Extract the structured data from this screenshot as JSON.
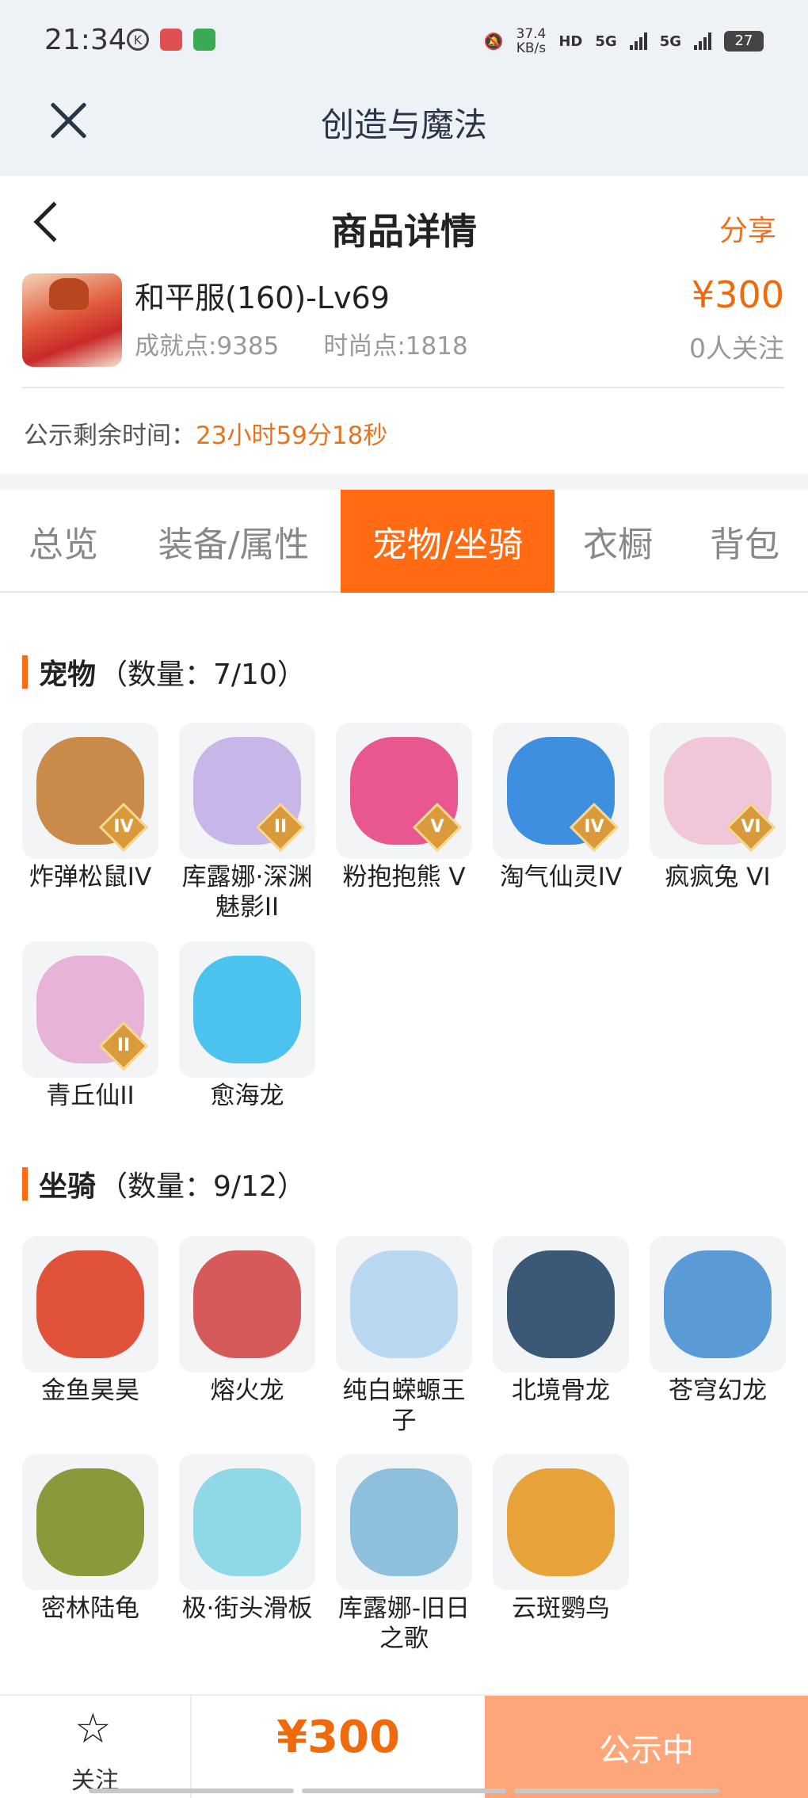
{
  "status_bar": {
    "time": "21:34",
    "speed_value": "37.4",
    "speed_unit": "KB/s",
    "hd_label": "HD",
    "sig1": "5G",
    "sig2": "5G",
    "battery": "27"
  },
  "app_bar": {
    "title": "创造与魔法",
    "close_icon": "close-icon"
  },
  "header": {
    "title": "商品详情",
    "share_label": "分享",
    "back_icon": "back-icon"
  },
  "product": {
    "name": "和平服(160)-Lv69",
    "achievement": "成就点:9385",
    "fashion": "时尚点:1818",
    "price": "¥300",
    "follows": "0人关注",
    "notice_label": "公示剩余时间：",
    "notice_time": "23小时59分18秒"
  },
  "tabs": [
    "总览",
    "装备/属性",
    "宠物/坐骑",
    "衣橱",
    "背包"
  ],
  "active_tab": 2,
  "pets": {
    "title": "宠物",
    "count": "（数量：7/10）",
    "items": [
      {
        "name": "炸弹松鼠IV",
        "badge": "IV",
        "color": "#c98a4a"
      },
      {
        "name": "库露娜·深渊魅影II",
        "badge": "II",
        "color": "#c9b6e8"
      },
      {
        "name": "粉抱抱熊 V",
        "badge": "V",
        "color": "#e8578f"
      },
      {
        "name": "淘气仙灵IV",
        "badge": "IV",
        "color": "#3f8fe0"
      },
      {
        "name": "疯疯兔 VI",
        "badge": "VI",
        "color": "#f0c6d8"
      },
      {
        "name": "青丘仙II",
        "badge": "II",
        "color": "#e7b3d6"
      },
      {
        "name": "愈海龙",
        "badge": "",
        "color": "#4cc3ee"
      }
    ]
  },
  "mounts": {
    "title": "坐骑",
    "count": "（数量：9/12）",
    "items": [
      {
        "name": "金鱼昊昊",
        "color": "#e0523a"
      },
      {
        "name": "熔火龙",
        "color": "#d65a5a"
      },
      {
        "name": "纯白蝾螈王子",
        "color": "#b9d9f2"
      },
      {
        "name": "北境骨龙",
        "color": "#3c5877"
      },
      {
        "name": "苍穹幻龙",
        "color": "#5a9ad6"
      },
      {
        "name": "密林陆龟",
        "color": "#8a9a3a"
      },
      {
        "name": "极·街头滑板",
        "color": "#8fd8e8"
      },
      {
        "name": "库露娜-旧日之歌",
        "color": "#8ec0de"
      },
      {
        "name": "云斑鹦鸟",
        "color": "#e8a23a"
      }
    ]
  },
  "bottom_bar": {
    "follow_label": "关注",
    "price": "¥300",
    "status": "公示中"
  },
  "colors": {
    "accent": "#ff6a13",
    "price": "#ee6a0c",
    "status_button": "#fda67a"
  }
}
